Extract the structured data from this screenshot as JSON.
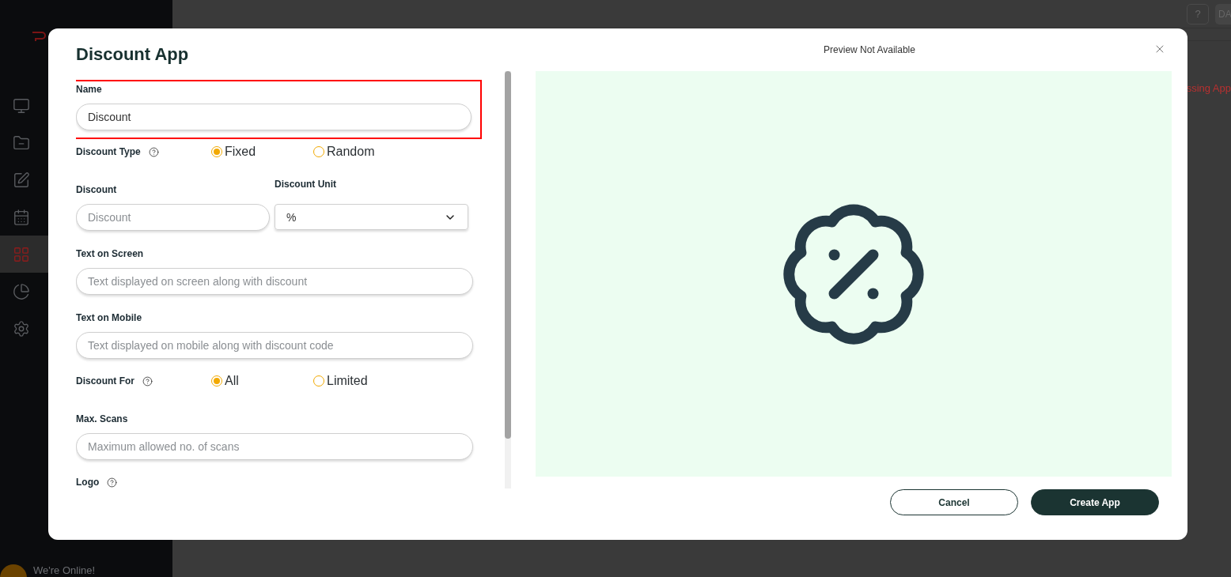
{
  "background": {
    "sidebar": {
      "items": [
        {
          "selected": false
        },
        {
          "selected": false
        },
        {
          "selected": false
        },
        {
          "selected": false
        },
        {
          "selected": true
        },
        {
          "selected": false
        },
        {
          "selected": false
        }
      ],
      "status": "We're Online!"
    },
    "topbar": {
      "help_button": "?",
      "user_button": "DA"
    },
    "notice": "ssing App"
  },
  "dialog": {
    "title": "Discount App",
    "preview_title": "Preview Not Available",
    "fields": [
      {
        "kind": "text",
        "label": "Name",
        "value": "Discount",
        "highlighted": true
      },
      {
        "kind": "radio",
        "label": "Discount Type",
        "help": true,
        "options": [
          {
            "label": "Fixed",
            "selected": true
          },
          {
            "label": "Random",
            "selected": false
          }
        ]
      },
      {
        "kind": "pair",
        "items": [
          {
            "kind": "text",
            "label": "Discount",
            "placeholder": "Discount"
          },
          {
            "kind": "select",
            "label": "Discount Unit",
            "value": "%"
          }
        ]
      },
      {
        "kind": "text",
        "label": "Text on Screen",
        "placeholder": "Text displayed on screen along with discount"
      },
      {
        "kind": "text",
        "label": "Text on Mobile",
        "placeholder": "Text displayed on mobile along with discount code"
      },
      {
        "kind": "radio",
        "label": "Discount For",
        "help": true,
        "options": [
          {
            "label": "All",
            "selected": true
          },
          {
            "label": "Limited",
            "selected": false
          }
        ]
      },
      {
        "kind": "text",
        "label": "Max. Scans",
        "placeholder": "Maximum allowed no. of scans"
      },
      {
        "kind": "label",
        "label": "Logo",
        "help": true
      }
    ],
    "buttons": [
      {
        "kind": "secondary",
        "label": "Cancel"
      },
      {
        "kind": "primary",
        "label": "Create App"
      }
    ]
  }
}
